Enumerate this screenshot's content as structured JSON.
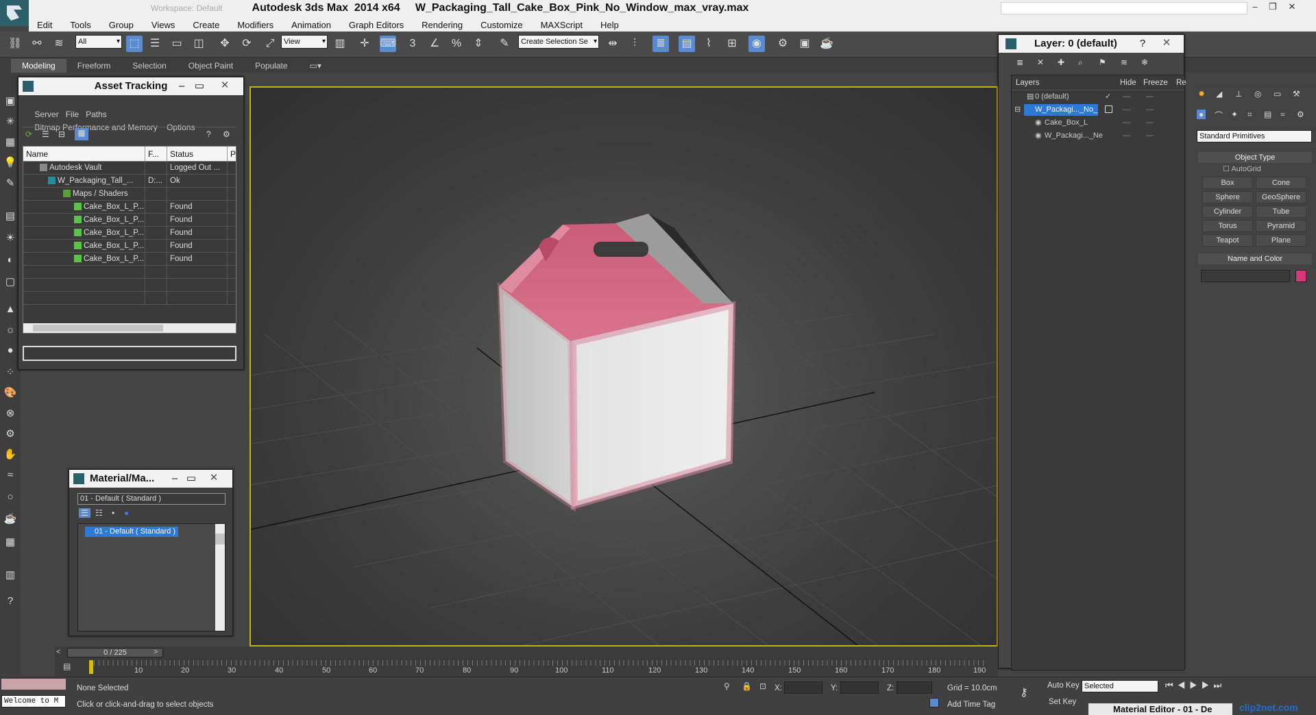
{
  "app": {
    "title": "Autodesk 3ds Max  2014 x64     W_Packaging_Tall_Cake_Box_Pink_No_Window_max_vray.max",
    "workspace_label": "Workspace: Default"
  },
  "menu": [
    "Edit",
    "Tools",
    "Group",
    "Views",
    "Create",
    "Modifiers",
    "Animation",
    "Graph Editors",
    "Rendering",
    "Customize",
    "MAXScript",
    "Help"
  ],
  "toolbar": {
    "selection_filter": "All",
    "reference_coord": "View",
    "named_selection": "Create Selection Se"
  },
  "ribbon_tabs": [
    "Modeling",
    "Freeform",
    "Selection",
    "Object Paint",
    "Populate"
  ],
  "asset_tracking": {
    "title": "Asset Tracking",
    "menu_row1": [
      "Server",
      "File",
      "Paths"
    ],
    "menu_row2": [
      "Bitmap Performance and Memory",
      "Options"
    ],
    "columns": [
      "Name",
      "F...",
      "Status",
      "P"
    ],
    "rows": [
      {
        "name": "Autodesk Vault",
        "f": "",
        "status": "Logged Out ..."
      },
      {
        "name": "W_Packaging_Tall_...",
        "f": "D:...",
        "status": "Ok"
      },
      {
        "name": "Maps / Shaders",
        "f": "",
        "status": ""
      },
      {
        "name": "Cake_Box_L_P...",
        "f": "",
        "status": "Found"
      },
      {
        "name": "Cake_Box_L_P...",
        "f": "",
        "status": "Found"
      },
      {
        "name": "Cake_Box_L_P...",
        "f": "",
        "status": "Found"
      },
      {
        "name": "Cake_Box_L_P...",
        "f": "",
        "status": "Found"
      },
      {
        "name": "Cake_Box_L_P...",
        "f": "",
        "status": "Found"
      }
    ]
  },
  "material_map": {
    "title": "Material/Ma...",
    "field_value": "01 - Default  ( Standard )",
    "list_item": "01 - Default  ( Standard )"
  },
  "layer_panel": {
    "title": "Layer: 0 (default)",
    "help": "?",
    "columns": [
      "Layers",
      "Hide",
      "Freeze",
      "Re"
    ],
    "rows": [
      {
        "name": "0 (default)",
        "indent": 0,
        "selected": false
      },
      {
        "name": "W_Packagi..._No_",
        "indent": 0,
        "selected": true
      },
      {
        "name": "Cake_Box_L",
        "indent": 1,
        "selected": false
      },
      {
        "name": "W_Packagi..._Ne",
        "indent": 1,
        "selected": false
      }
    ]
  },
  "command_panel": {
    "category": "Standard Primitives",
    "object_type_title": "Object Type",
    "autogrid": "AutoGrid",
    "buttons": [
      "Box",
      "Cone",
      "Sphere",
      "GeoSphere",
      "Cylinder",
      "Tube",
      "Torus",
      "Pyramid",
      "Teapot",
      "Plane"
    ],
    "name_color_title": "Name and Color",
    "swatch_color": "#d8357a"
  },
  "timeline": {
    "frame_display": "0 / 225",
    "ticks": [
      "10",
      "20",
      "30",
      "40",
      "50",
      "60",
      "70",
      "80",
      "90",
      "100",
      "110",
      "120",
      "130",
      "140",
      "150",
      "160",
      "170",
      "180",
      "190"
    ]
  },
  "status": {
    "maxscript": "Welcome to M",
    "selection": "None Selected",
    "prompt": "Click or click-and-drag to select objects",
    "x_label": "X:",
    "y_label": "Y:",
    "z_label": "Z:",
    "grid": "Grid = 10.0cm",
    "add_time_tag": "Add Time Tag",
    "auto_key": "Auto Key",
    "set_key": "Set Key",
    "key_filter": "Selected",
    "taskbar_window": "Material Editor - 01 - De",
    "watermark": "clip2net.com"
  },
  "colors": {
    "accent": "#5a8ad0",
    "viewport_border": "#c8b400",
    "box_lid": "#d86580",
    "selection_blue": "#2e78d6"
  }
}
